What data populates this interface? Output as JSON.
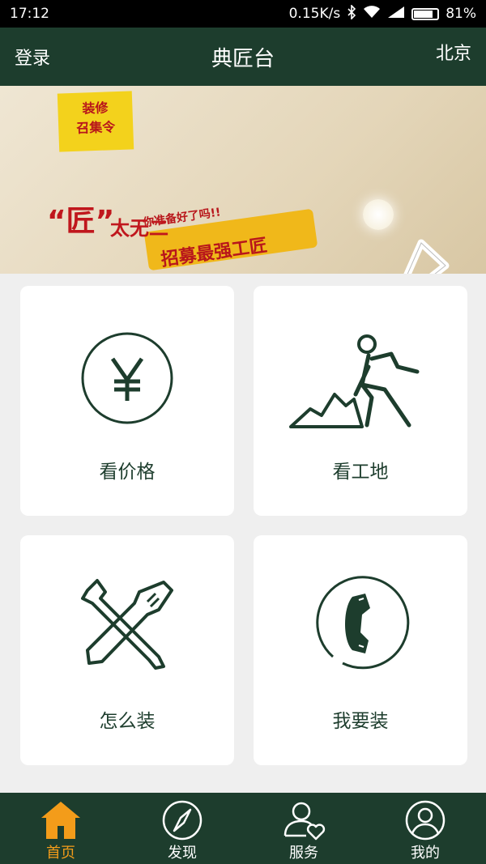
{
  "status_bar": {
    "time": "17:12",
    "speed": "0.15K/s",
    "battery": "81%",
    "battery_level": 0.81
  },
  "header": {
    "left": "登录",
    "title": "典匠台",
    "right": "北京"
  },
  "banner": {
    "tag_line1": "装修",
    "tag_line2": "召集令",
    "question": "你准备好了吗!!",
    "slogan": "招募最强工匠",
    "big_char": "“匠”",
    "tagline": "太无二",
    "dots": 4,
    "active_dot": 4
  },
  "cards": [
    {
      "label": "看价格",
      "icon": "yen-circle-icon"
    },
    {
      "label": "看工地",
      "icon": "worker-digging-icon"
    },
    {
      "label": "怎么装",
      "icon": "wrench-screwdriver-icon"
    },
    {
      "label": "我要装",
      "icon": "phone-circle-icon"
    }
  ],
  "tabs": [
    {
      "label": "首页",
      "icon": "home-icon",
      "active": true
    },
    {
      "label": "发现",
      "icon": "compass-icon",
      "active": false
    },
    {
      "label": "服务",
      "icon": "user-heart-icon",
      "active": false
    },
    {
      "label": "我的",
      "icon": "profile-icon",
      "active": false
    }
  ],
  "colors": {
    "primary": "#1d3d2d",
    "accent": "#f39c1a",
    "background": "#efefef",
    "banner_red": "#c0171d"
  }
}
